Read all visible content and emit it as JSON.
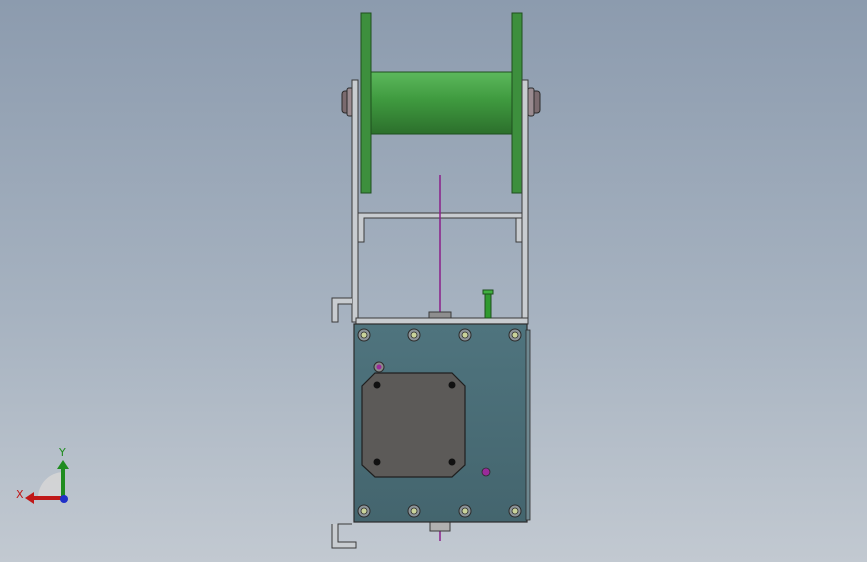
{
  "window": {
    "background_top": "#8c9bae",
    "background_bottom": "#c2c9d1"
  },
  "model": {
    "spool_color": "#3f9a3f",
    "frame_color": "#c7cbcf",
    "panel_color": "#4b6e78",
    "motor_color": "#5c5a58",
    "cable_color": "#8a1f8a"
  },
  "triad": {
    "x_label": "X",
    "y_label": "Y",
    "x_color": "#c01818",
    "y_color": "#1f8c1f",
    "z_color": "#2030c8",
    "icon": "view-orientation-triad-icon"
  }
}
